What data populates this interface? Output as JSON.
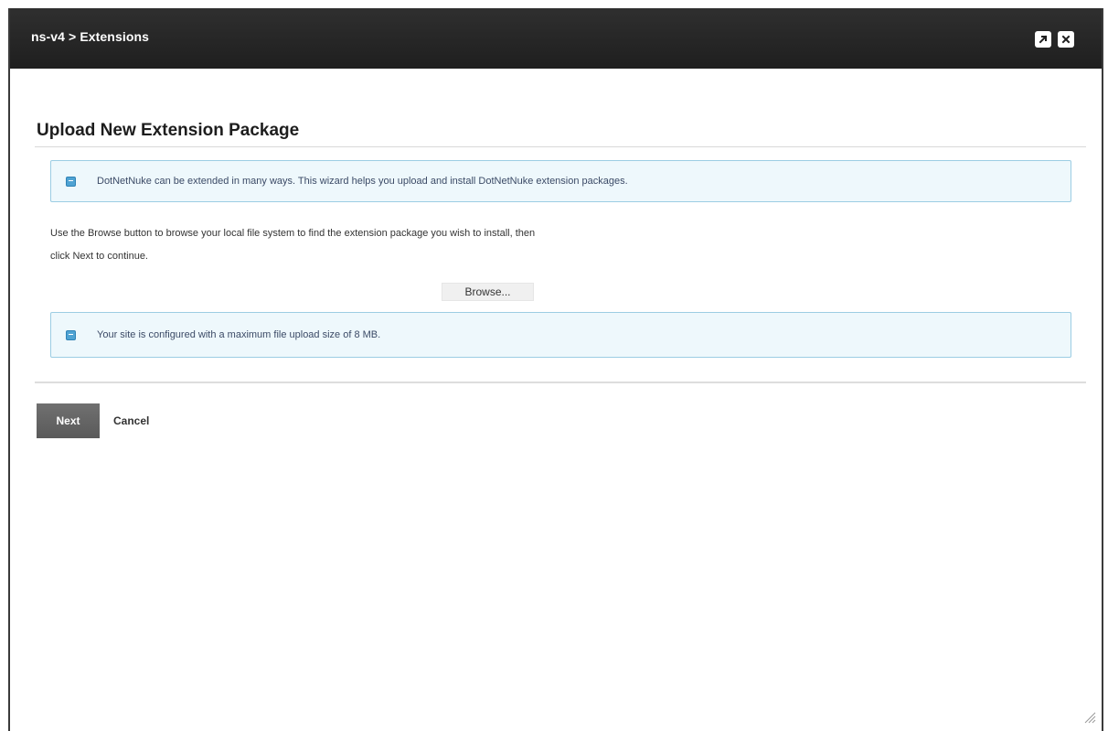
{
  "window": {
    "title": "ns-v4 > Extensions",
    "maximize_icon": "external-link-icon",
    "close_icon": "close-icon"
  },
  "main": {
    "heading": "Upload New Extension Package",
    "info_intro": "DotNetNuke can be extended in many ways. This wizard helps you upload and install DotNetNuke extension packages.",
    "instructions_line1": "Use the Browse button to browse your local file system to find the extension package you wish to install, then",
    "instructions_line2": "click Next to continue.",
    "browse_label": "Browse...",
    "info_limit": "Your site is configured with a maximum file upload size of 8 MB."
  },
  "actions": {
    "next_label": "Next",
    "cancel_label": "Cancel"
  },
  "colors": {
    "titlebar": "#232323",
    "info_bg": "#eef8fc",
    "info_border": "#9ccde3",
    "next_bg": "#626262"
  }
}
